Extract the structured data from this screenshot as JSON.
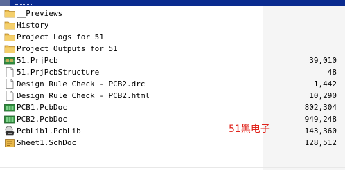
{
  "top_bar": {
    "text": ".."
  },
  "files": [
    {
      "name": "__Previews",
      "size": "",
      "icon": "folder-icon"
    },
    {
      "name": "History",
      "size": "",
      "icon": "folder-icon"
    },
    {
      "name": "Project Logs for 51",
      "size": "",
      "icon": "folder-icon"
    },
    {
      "name": "Project Outputs for 51",
      "size": "",
      "icon": "folder-icon"
    },
    {
      "name": "51.PrjPcb",
      "size": "39,010",
      "icon": "pcb-project-icon"
    },
    {
      "name": "51.PrjPcbStructure",
      "size": "48",
      "icon": "document-icon"
    },
    {
      "name": "Design Rule Check - PCB2.drc",
      "size": "1,442",
      "icon": "document-icon"
    },
    {
      "name": "Design Rule Check - PCB2.html",
      "size": "10,290",
      "icon": "document-icon"
    },
    {
      "name": "PCB1.PcbDoc",
      "size": "802,304",
      "icon": "pcb-doc-icon"
    },
    {
      "name": "PCB2.PcbDoc",
      "size": "949,248",
      "icon": "pcb-doc-icon"
    },
    {
      "name": "PcbLib1.PcbLib",
      "size": "143,360",
      "icon": "pcb-lib-icon"
    },
    {
      "name": "Sheet1.SchDoc",
      "size": "128,512",
      "icon": "schematic-doc-icon"
    }
  ],
  "watermark": {
    "text": "51黑电子"
  },
  "colors": {
    "selection": "#0a2b8f",
    "folder": "#e8b84a",
    "pcb": "#2f8a3c",
    "watermark": "#e0241c"
  }
}
